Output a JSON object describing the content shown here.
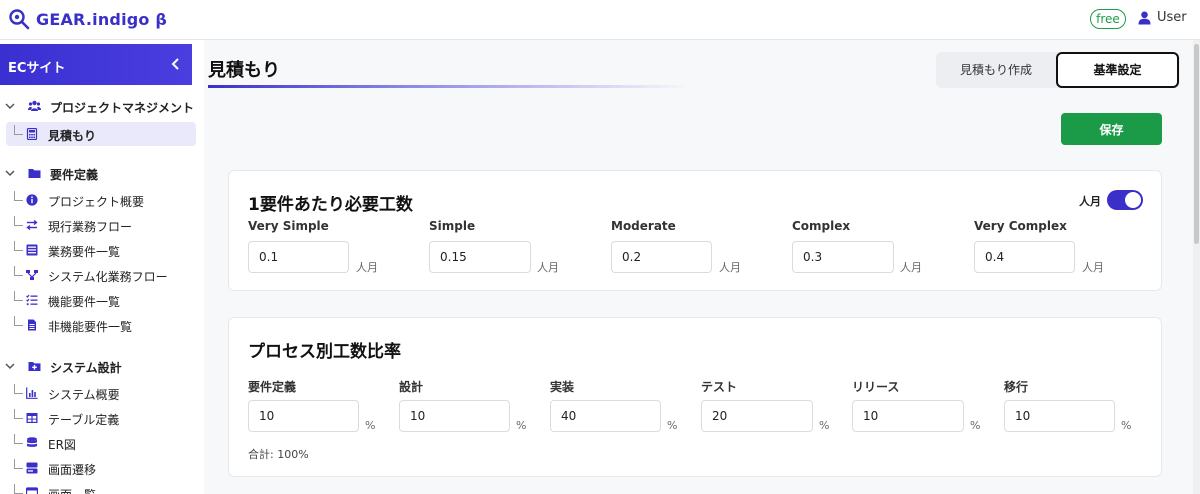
{
  "app": {
    "title": "GEAR.indigo β",
    "badge": "free",
    "user": "User"
  },
  "sidebar": {
    "project": "ECサイト",
    "groups": [
      {
        "label": "プロジェクトマネジメント",
        "icon": "users-icon",
        "items": [
          {
            "label": "見積もり",
            "icon": "calculator-icon",
            "active": true
          }
        ]
      },
      {
        "label": "要件定義",
        "icon": "folder-icon",
        "items": [
          {
            "label": "プロジェクト概要",
            "icon": "info-icon"
          },
          {
            "label": "現行業務フロー",
            "icon": "exchange-icon"
          },
          {
            "label": "業務要件一覧",
            "icon": "list-icon"
          },
          {
            "label": "システム化業務フロー",
            "icon": "sitemap-icon"
          },
          {
            "label": "機能要件一覧",
            "icon": "checklist-icon"
          },
          {
            "label": "非機能要件一覧",
            "icon": "document-icon"
          }
        ]
      },
      {
        "label": "システム設計",
        "icon": "folder-plus-icon",
        "items": [
          {
            "label": "システム概要",
            "icon": "chart-icon"
          },
          {
            "label": "テーブル定義",
            "icon": "table-icon"
          },
          {
            "label": "ER図",
            "icon": "database-icon"
          },
          {
            "label": "画面遷移",
            "icon": "screen-icon"
          },
          {
            "label": "画面一覧",
            "icon": "window-icon"
          }
        ]
      }
    ]
  },
  "main": {
    "title": "見積もり",
    "tabs": [
      "見積もり作成",
      "基準設定"
    ],
    "active_tab": "基準設定",
    "save_label": "保存",
    "effort": {
      "title": "1要件あたり必要工数",
      "toggle_label": "人月",
      "toggle_on": true,
      "fields": [
        {
          "label": "Very Simple",
          "value": "0.1",
          "unit": "人月"
        },
        {
          "label": "Simple",
          "value": "0.15",
          "unit": "人月"
        },
        {
          "label": "Moderate",
          "value": "0.2",
          "unit": "人月"
        },
        {
          "label": "Complex",
          "value": "0.3",
          "unit": "人月"
        },
        {
          "label": "Very Complex",
          "value": "0.4",
          "unit": "人月"
        }
      ]
    },
    "process": {
      "title": "プロセス別工数比率",
      "fields": [
        {
          "label": "要件定義",
          "value": "10",
          "unit": "%"
        },
        {
          "label": "設計",
          "value": "10",
          "unit": "%"
        },
        {
          "label": "実装",
          "value": "40",
          "unit": "%"
        },
        {
          "label": "テスト",
          "value": "20",
          "unit": "%"
        },
        {
          "label": "リリース",
          "value": "10",
          "unit": "%"
        },
        {
          "label": "移行",
          "value": "10",
          "unit": "%"
        }
      ],
      "total": "合計: 100%"
    }
  },
  "colors": {
    "brand": "#3b2fc9",
    "save": "#1b9b48",
    "free": "#1e9b49"
  }
}
